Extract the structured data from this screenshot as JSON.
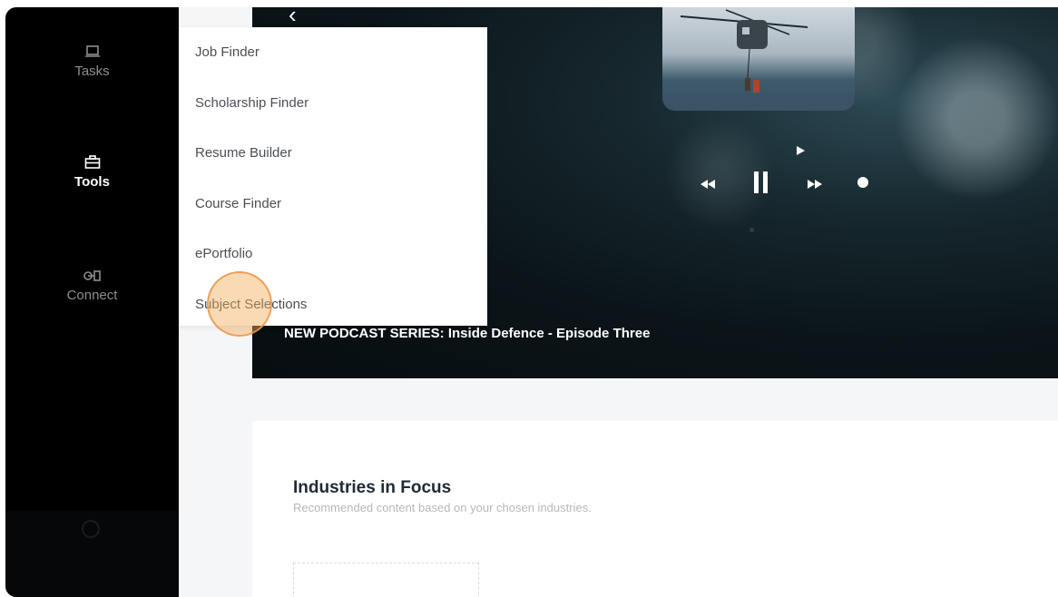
{
  "sidebar": {
    "items": [
      {
        "label": "Tasks",
        "icon": "laptop-icon",
        "active": false
      },
      {
        "label": "Tools",
        "icon": "briefcase-icon",
        "active": true
      },
      {
        "label": "Connect",
        "icon": "connect-icon",
        "active": false
      }
    ]
  },
  "menu": {
    "items": [
      {
        "label": "Job Finder"
      },
      {
        "label": "Scholarship Finder"
      },
      {
        "label": "Resume Builder"
      },
      {
        "label": "Course Finder"
      },
      {
        "label": "ePortfolio"
      },
      {
        "label": "Subject Selections"
      }
    ]
  },
  "hero": {
    "caption": "NEW PODCAST SERIES: Inside Defence - Episode Three"
  },
  "section": {
    "title": "Industries in Focus",
    "subtitle": "Recommended content based on your chosen industries."
  },
  "colors": {
    "sidebar_bg": "#000000",
    "active_text": "#ffffff",
    "inactive_text": "#8e8e8e",
    "highlight": "#f0a050"
  }
}
